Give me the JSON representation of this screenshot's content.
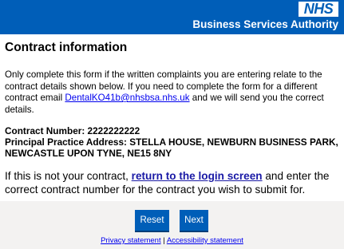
{
  "header": {
    "logo_text": "NHS",
    "org_name": "Business Services Authority"
  },
  "main": {
    "title": "Contract information",
    "intro": {
      "text_before_link": "Only complete this form if the written complaints you are entering relate to the contract details shown below. If you need to complete the form for a different contract email ",
      "email": "DentalKO41b@nhsbsa.nhs.uk",
      "text_after_link": " and we will send you the correct details."
    },
    "contract": {
      "number_line": "Contract Number: 2222222222",
      "address_line1": "Principal Practice Address: STELLA HOUSE, NEWBURN BUSINESS PARK,",
      "address_line2": "NEWCASTLE UPON TYNE, NE15 8NY"
    },
    "not_yours": {
      "text_before_link": "If this is not your contract, ",
      "link_text": "return to the login screen",
      "text_after_link": " and enter the correct contract number for the contract you wish to submit for."
    }
  },
  "footer": {
    "reset_label": "Reset",
    "next_label": "Next",
    "privacy_link": "Privacy statement",
    "separator": " | ",
    "accessibility_link": "Accessibility statement"
  },
  "colors": {
    "nhs_blue": "#005EB8",
    "footer_bg": "#f3f2f1",
    "link": "#0000EE"
  }
}
